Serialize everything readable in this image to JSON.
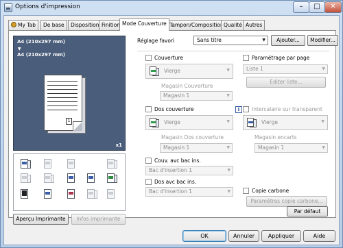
{
  "window": {
    "title": "Options d'impression",
    "min_label": "–",
    "max_label": "□",
    "close_label": "✕"
  },
  "tabs": [
    {
      "label": "My Tab",
      "icon": "user-icon"
    },
    {
      "label": "De base"
    },
    {
      "label": "Disposition"
    },
    {
      "label": "Finition"
    },
    {
      "label": "Mode Couverture",
      "active": true
    },
    {
      "label": "Tampon/Composition"
    },
    {
      "label": "Qualité"
    },
    {
      "label": "Autres"
    }
  ],
  "preview": {
    "paper_line_1": "A4 (210x297 mm)",
    "arrow": "▼",
    "paper_line_2": "A4 (210x297 mm)",
    "page_badge": "1",
    "copies": "x1"
  },
  "preview_buttons": {
    "printer_view": "Aperçu Imprimante",
    "printer_info": "Infos imprimante"
  },
  "favorites": {
    "label": "Réglage favori",
    "value": "Sans titre",
    "add_button": "Ajouter...",
    "modify_button": "Modifier..."
  },
  "cover": {
    "front": {
      "label": "Couverture",
      "type_value": "Vierge",
      "tray_label": "Magasin Couverture",
      "tray_value": "Magasin 1"
    },
    "back": {
      "label": "Dos couverture",
      "type_value": "Vierge",
      "tray_label": "Magasin Dos couverture",
      "tray_value": "Magasin 1"
    },
    "front_tray_insert": {
      "label": "Couv. avc bac ins.",
      "value": "Bac d'insertion 1"
    },
    "back_tray_insert": {
      "label": "Dos avc bac ins.",
      "value": "Bac d'insertion 1"
    }
  },
  "per_page": {
    "label": "Paramétrage par page",
    "list_value": "Liste 1",
    "edit_button": "Editer liste..."
  },
  "transparency": {
    "info_label": "i",
    "label": "Intercalaire sur transparent",
    "type_value": "Vierge",
    "tray_label": "Magasin encarts",
    "tray_value": "Magasin 1"
  },
  "carbon": {
    "label": "Copie carbone",
    "settings_button": "Paramètres copie carbone..."
  },
  "defaults_button": "Par défaut",
  "footer": {
    "ok": "OK",
    "cancel": "Annuler",
    "apply": "Appliquer",
    "help": "Aide"
  }
}
